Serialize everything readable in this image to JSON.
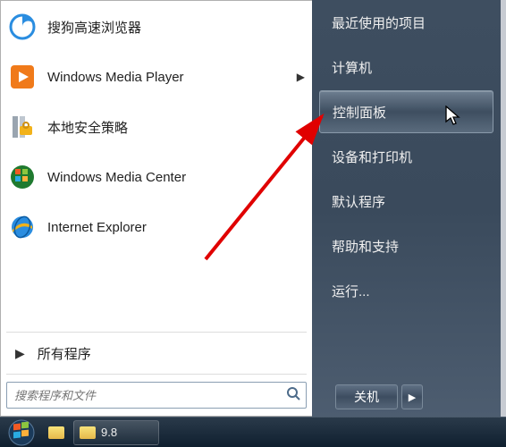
{
  "left": {
    "programs": [
      {
        "label": "搜狗高速浏览器",
        "has_submenu": false,
        "icon": "sogou"
      },
      {
        "label": "Windows Media Player",
        "has_submenu": true,
        "icon": "wmp"
      },
      {
        "label": "本地安全策略",
        "has_submenu": false,
        "icon": "policy"
      },
      {
        "label": "Windows Media Center",
        "has_submenu": false,
        "icon": "wmc"
      },
      {
        "label": "Internet Explorer",
        "has_submenu": false,
        "icon": "ie"
      }
    ],
    "all_programs_label": "所有程序",
    "search_placeholder": "搜索程序和文件"
  },
  "right": {
    "items": [
      {
        "label": "最近使用的项目",
        "highlight": false
      },
      {
        "label": "计算机",
        "highlight": false
      },
      {
        "label": "控制面板",
        "highlight": true
      },
      {
        "label": "设备和打印机",
        "highlight": false
      },
      {
        "label": "默认程序",
        "highlight": false
      },
      {
        "label": "帮助和支持",
        "highlight": false
      },
      {
        "label": "运行...",
        "highlight": false
      }
    ],
    "shutdown_label": "关机"
  },
  "taskbar": {
    "running_label": "9.8"
  }
}
